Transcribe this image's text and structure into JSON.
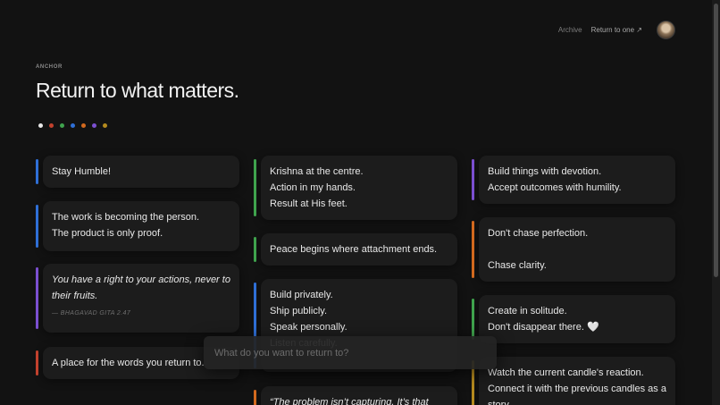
{
  "nav": {
    "archive": "Archive",
    "return_to_one": "Return to one ↗"
  },
  "header": {
    "eyebrow": "ANCHOR",
    "title": "Return to what matters."
  },
  "colors": [
    "#e8e8e8",
    "#c2412d",
    "#3fa34d",
    "#2f6fd6",
    "#d2691e",
    "#7b4fd0",
    "#b58a1e"
  ],
  "cards": {
    "c1": "Stay Humble!",
    "c2": "The work is becoming the person.\nThe product is only proof.",
    "c3": "You have a right to your actions, never to their fruits.",
    "c3_cite": "— BHAGAVAD GITA 2.47",
    "c4": "A place for the words you return to.",
    "c5": "Krishna at the centre.\nAction in my hands.\nResult at His feet.",
    "c6": "Peace begins where attachment ends.",
    "c7": "Build privately.\nShip publicly.\nSpeak personally.\nListen carefully.",
    "c8": "“The problem isn’t capturing. It’s that",
    "c9": "Build things with devotion.\nAccept outcomes with humility.",
    "c10": "Don't chase perfection.\n\nChase clarity.",
    "c11": "Create in solitude.\nDon't disappear there. 🤍",
    "c12": "Watch the current candle's reaction.\nConnect it with the previous candles as a story."
  },
  "search": {
    "placeholder": "What do you want to return to?"
  }
}
